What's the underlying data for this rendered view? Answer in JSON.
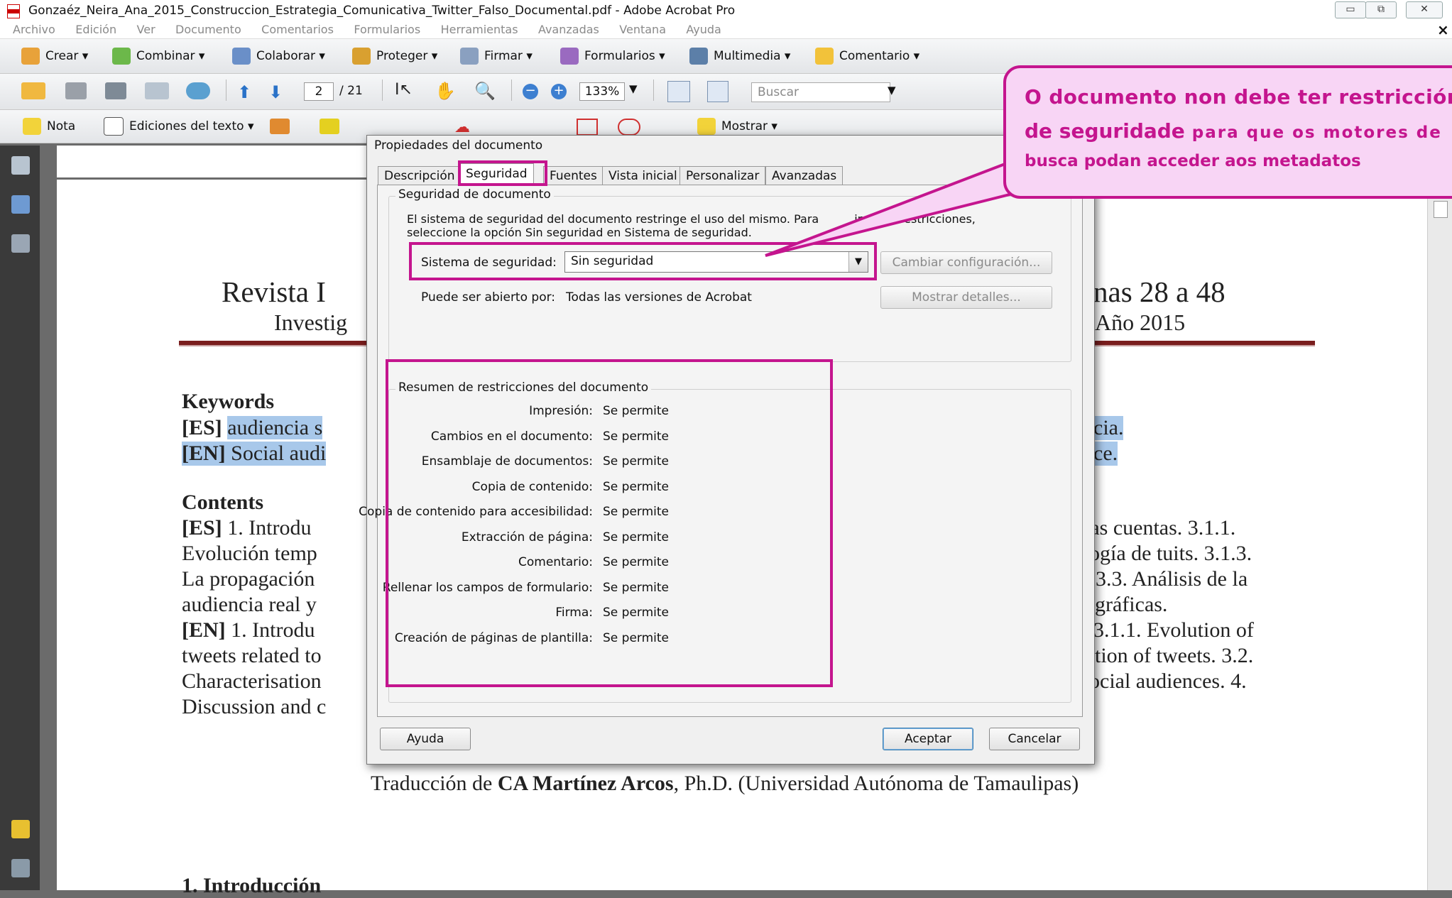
{
  "window": {
    "title": "Gonzaéz_Neira_Ana_2015_Construccion_Estrategia_Comunicativa_Twitter_Falso_Documental.pdf - Adobe Acrobat Pro",
    "close_glyph": "×"
  },
  "menu": [
    "Archivo",
    "Edición",
    "Ver",
    "Documento",
    "Comentarios",
    "Formularios",
    "Herramientas",
    "Avanzadas",
    "Ventana",
    "Ayuda"
  ],
  "toolbar1": {
    "crear": "Crear ▾",
    "combinar": "Combinar ▾",
    "colaborar": "Colaborar ▾",
    "proteger": "Proteger ▾",
    "firmar": "Firmar ▾",
    "formularios": "Formularios ▾",
    "multimedia": "Multimedia ▾",
    "comentario": "Comentario ▾"
  },
  "toolbar2": {
    "page_current": "2",
    "page_total": "/ 21",
    "zoom": "133%",
    "search_placeholder": "Buscar"
  },
  "toolbar3": {
    "nota": "Nota",
    "ediciones": "Ediciones del texto ▾",
    "mostrar": "Mostrar ▾"
  },
  "doc": {
    "header_left": "Revista I",
    "header_right": "nas 28 a 48",
    "sub_left": "Investig",
    "sub_right": "Año 2015",
    "keywords_title": "Keywords",
    "kw_es_tag": "[ES]",
    "kw_es_text": "audiencia s",
    "kw_es_end": "cia.",
    "kw_en_tag": "[EN]",
    "kw_en_text": "Social audi",
    "kw_en_end": "ce.",
    "contents_title": "Contents",
    "c_line1_tag": "[ES]",
    "c_line1_text": " 1. Introdu",
    "c_line1_end": "las cuentas. 3.1.1.",
    "c_line2": "Evolución temp",
    "c_line2_end": "ogía de tuits. 3.1.3.",
    "c_line3": "La propagación",
    "c_line3_end": "3.3. Análisis de la",
    "c_line4": "audiencia real y",
    "c_line4_end": "gráficas.",
    "c_line5_tag": "[EN]",
    "c_line5_text": " 1. Introdu",
    "c_line5_end": "3.1.1. Evolution of",
    "c_line6": "tweets related to",
    "c_line6_end": "tion of tweets. 3.2.",
    "c_line7": "Characterisation",
    "c_line7_end": "ocial audiences. 4.",
    "c_line8": "Discussion and c",
    "translation_pre": "Traducción de ",
    "translation_bold": "CA Martínez Arcos",
    "translation_post": ", Ph.D. (Universidad Autónoma de Tamaulipas)",
    "intro_heading": "1. Introducción"
  },
  "dialog": {
    "title": "Propiedades del documento",
    "tabs": [
      "Descripción",
      "Seguridad",
      "Fuentes",
      "Vista inicial",
      "Personalizar",
      "Avanzadas"
    ],
    "security_group_title": "Seguridad de documento",
    "security_desc_1": "El sistema de seguridad del documento restringe el uso del mismo. Para",
    "security_desc_1b": "inar las restricciones,",
    "security_desc_2": "seleccione la opción Sin seguridad en Sistema de seguridad.",
    "system_label": "Sistema de seguridad:",
    "system_value": "Sin seguridad",
    "change_button": "Cambiar configuración...",
    "open_by_label": "Puede ser abierto por:",
    "open_by_value": "Todas las versiones de Acrobat",
    "details_button": "Mostrar detalles...",
    "summary_title": "Resumen de restricciones del documento",
    "restrictions": [
      {
        "label": "Impresión:",
        "value": "Se permite"
      },
      {
        "label": "Cambios en el documento:",
        "value": "Se permite"
      },
      {
        "label": "Ensamblaje de documentos:",
        "value": "Se permite"
      },
      {
        "label": "Copia de contenido:",
        "value": "Se permite"
      },
      {
        "label": "Copia de contenido para accesibilidad:",
        "value": "Se permite"
      },
      {
        "label": "Extracción de página:",
        "value": "Se permite"
      },
      {
        "label": "Comentario:",
        "value": "Se permite"
      },
      {
        "label": "Rellenar los campos de formulario:",
        "value": "Se permite"
      },
      {
        "label": "Firma:",
        "value": "Se permite"
      },
      {
        "label": "Creación de páginas de plantilla:",
        "value": "Se permite"
      }
    ],
    "help_button": "Ayuda",
    "ok_button": "Aceptar",
    "cancel_button": "Cancelar"
  },
  "callout": {
    "line1": "O documento non debe ter restriccións",
    "line2_big": "de seguridade",
    "line2_small": " para que os motores de",
    "line3": "busca podan acceder aos metadatos",
    "color": "#c4158e"
  }
}
